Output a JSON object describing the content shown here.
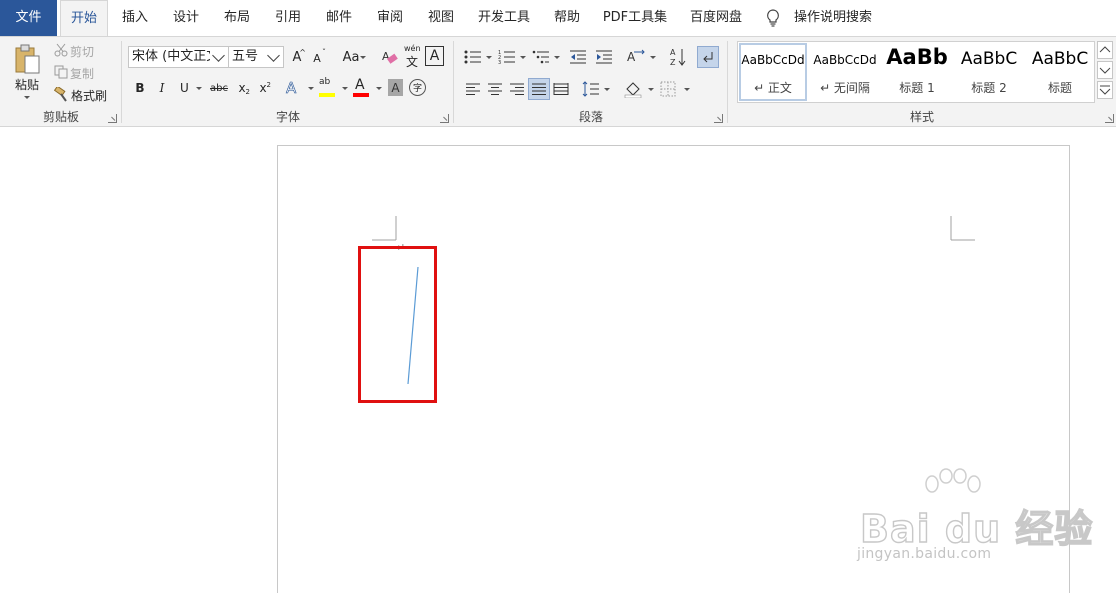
{
  "tabs": [
    {
      "label": "文件"
    },
    {
      "label": "开始"
    },
    {
      "label": "插入"
    },
    {
      "label": "设计"
    },
    {
      "label": "布局"
    },
    {
      "label": "引用"
    },
    {
      "label": "邮件"
    },
    {
      "label": "审阅"
    },
    {
      "label": "视图"
    },
    {
      "label": "开发工具"
    },
    {
      "label": "帮助"
    },
    {
      "label": "PDF工具集"
    },
    {
      "label": "百度网盘"
    }
  ],
  "tell_me": {
    "label": "操作说明搜索",
    "icon": "lightbulb-icon"
  },
  "clipboard": {
    "paste": "粘贴",
    "cut": "剪切",
    "copy": "复制",
    "format_painter": "格式刷",
    "group_label": "剪贴板"
  },
  "font": {
    "font_name": "宋体 (中文正文)",
    "font_size": "五号",
    "grow": "A",
    "shrink": "A",
    "change_case": "Aa",
    "phonetic_top": "wén",
    "phonetic_bottom": "文",
    "char_border": "A",
    "bold": "B",
    "italic": "I",
    "underline": "U",
    "strikethrough": "abc",
    "subscript": "x",
    "superscript": "x",
    "subscript_mark": "2",
    "superscript_mark": "2",
    "text_effects": "A",
    "highlight": "ab",
    "font_color": "A",
    "char_shading": "A",
    "enclose": "字",
    "group_label": "字体"
  },
  "paragraph": {
    "group_label": "段落"
  },
  "styles": {
    "group_label": "样式",
    "items": [
      {
        "sample": "AaBbCcDd",
        "name": "↵ 正文"
      },
      {
        "sample": "AaBbCcDd",
        "name": "↵ 无间隔"
      },
      {
        "sample": "AaBb",
        "name": "标题 1"
      },
      {
        "sample": "AaBbC",
        "name": "标题 2"
      },
      {
        "sample": "AaBbC",
        "name": "标题"
      }
    ]
  },
  "document": {
    "paragraph_mark": "↵"
  },
  "watermark": {
    "main": "Bai du 经验",
    "sub": "jingyan.baidu.com"
  },
  "colors": {
    "file_tab": "#2b579a",
    "highlight_box": "#e01010",
    "drawn_line": "#5b9bd5",
    "font_color_bar": "#ff0000",
    "highlight_bar": "#ffff00"
  }
}
